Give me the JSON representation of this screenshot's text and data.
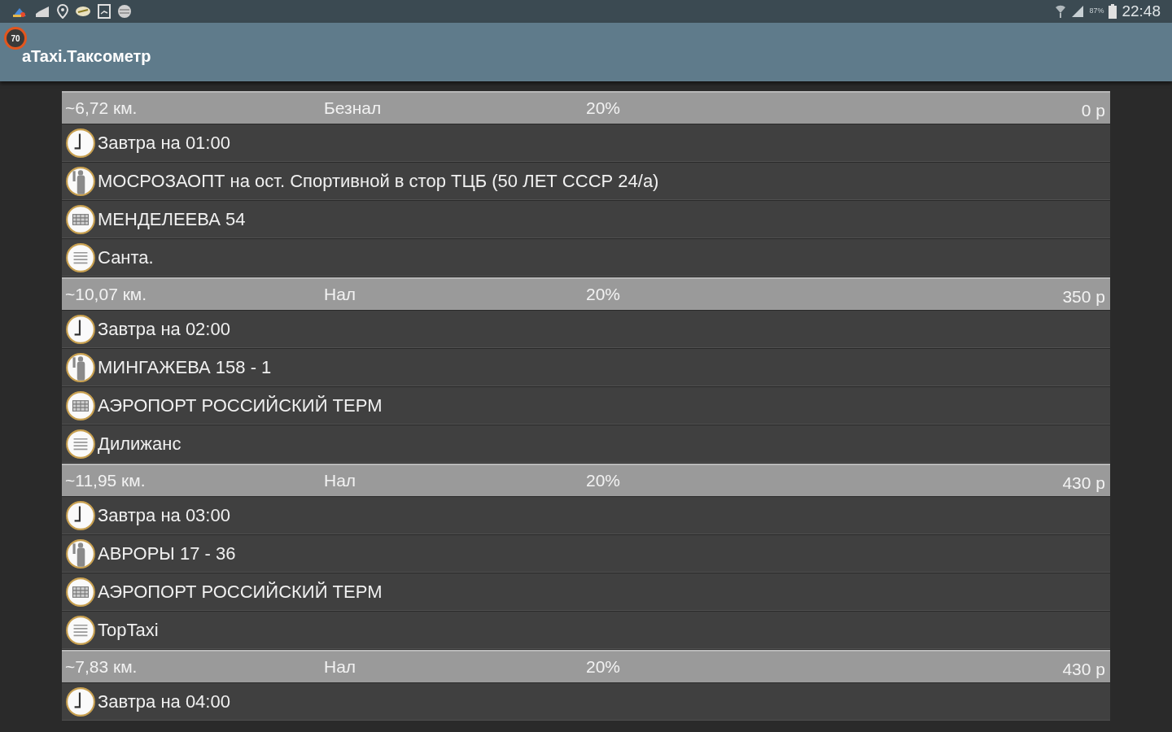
{
  "status_bar": {
    "battery_text": "87%",
    "time": "22:48"
  },
  "app_bar": {
    "badge": "70",
    "title": "aTaxi.Таксометр"
  },
  "orders": [
    {
      "distance": "~6,72 км.",
      "payment": "Безнал",
      "percent": "20%",
      "price": "0 р",
      "rows": [
        {
          "kind": "time",
          "text": "Завтра на 01:00"
        },
        {
          "kind": "pickup",
          "text": "МОСРОЗАОПТ на ост. Спортивной в стор ТЦБ (50 ЛЕТ СССР 24/а)"
        },
        {
          "kind": "destination",
          "text": "МЕНДЕЛЕЕВА 54"
        },
        {
          "kind": "note",
          "text": "Санта."
        }
      ]
    },
    {
      "distance": "~10,07 км.",
      "payment": "Нал",
      "percent": "20%",
      "price": "350 р",
      "rows": [
        {
          "kind": "time",
          "text": "Завтра на 02:00"
        },
        {
          "kind": "pickup",
          "text": "МИНГАЖЕВА 158 - 1"
        },
        {
          "kind": "destination",
          "text": "АЭРОПОРТ РОССИЙСКИЙ ТЕРМ"
        },
        {
          "kind": "note",
          "text": "Дилижанс"
        }
      ]
    },
    {
      "distance": "~11,95 км.",
      "payment": "Нал",
      "percent": "20%",
      "price": "430 р",
      "rows": [
        {
          "kind": "time",
          "text": "Завтра на 03:00"
        },
        {
          "kind": "pickup",
          "text": "АВРОРЫ 17 - 36"
        },
        {
          "kind": "destination",
          "text": "АЭРОПОРТ РОССИЙСКИЙ ТЕРМ"
        },
        {
          "kind": "note",
          "text": "TopTaxi"
        }
      ]
    },
    {
      "distance": "~7,83 км.",
      "payment": "Нал",
      "percent": "20%",
      "price": "430 р",
      "rows": [
        {
          "kind": "time",
          "text": "Завтра на 04:00"
        }
      ]
    }
  ]
}
